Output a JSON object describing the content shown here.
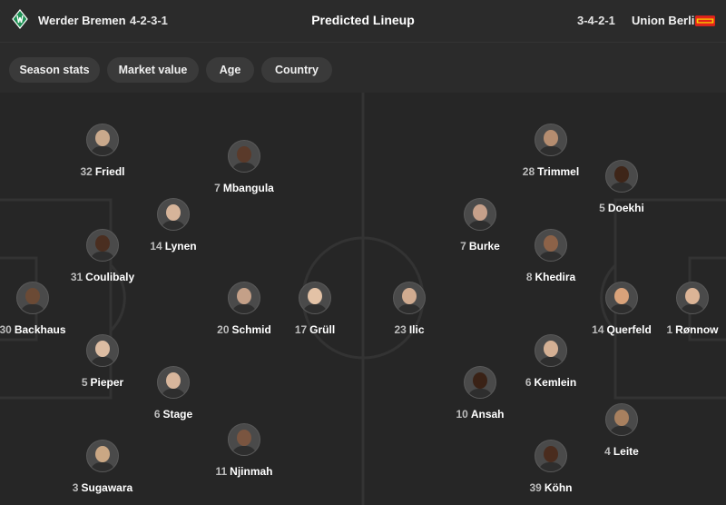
{
  "header": {
    "home_team": "Werder Bremen",
    "home_formation": "4-2-3-1",
    "title": "Predicted Lineup",
    "away_formation": "3-4-2-1",
    "away_team": "Union Berlin",
    "home_color": "#1d9053",
    "away_color": "#e2231a"
  },
  "tabs": [
    {
      "label": "Season stats"
    },
    {
      "label": "Market value"
    },
    {
      "label": "Age"
    },
    {
      "label": "Country"
    }
  ],
  "players": [
    {
      "number": "32",
      "name": "Friedl",
      "team": "home"
    },
    {
      "number": "7",
      "name": "Mbangula",
      "team": "home"
    },
    {
      "number": "14",
      "name": "Lynen",
      "team": "home"
    },
    {
      "number": "31",
      "name": "Coulibaly",
      "team": "home"
    },
    {
      "number": "30",
      "name": "Backhaus",
      "team": "home"
    },
    {
      "number": "20",
      "name": "Schmid",
      "team": "home"
    },
    {
      "number": "17",
      "name": "Grüll",
      "team": "home"
    },
    {
      "number": "5",
      "name": "Pieper",
      "team": "home"
    },
    {
      "number": "6",
      "name": "Stage",
      "team": "home"
    },
    {
      "number": "11",
      "name": "Njinmah",
      "team": "home"
    },
    {
      "number": "3",
      "name": "Sugawara",
      "team": "home"
    },
    {
      "number": "28",
      "name": "Trimmel",
      "team": "away"
    },
    {
      "number": "5",
      "name": "Doekhi",
      "team": "away"
    },
    {
      "number": "7",
      "name": "Burke",
      "team": "away"
    },
    {
      "number": "8",
      "name": "Khedira",
      "team": "away"
    },
    {
      "number": "23",
      "name": "Ilic",
      "team": "away"
    },
    {
      "number": "14",
      "name": "Querfeld",
      "team": "away"
    },
    {
      "number": "1",
      "name": "Rønnow",
      "team": "away"
    },
    {
      "number": "6",
      "name": "Kemlein",
      "team": "away"
    },
    {
      "number": "10",
      "name": "Ansah",
      "team": "away"
    },
    {
      "number": "4",
      "name": "Leite",
      "team": "away"
    },
    {
      "number": "39",
      "name": "Köhn",
      "team": "away"
    }
  ]
}
